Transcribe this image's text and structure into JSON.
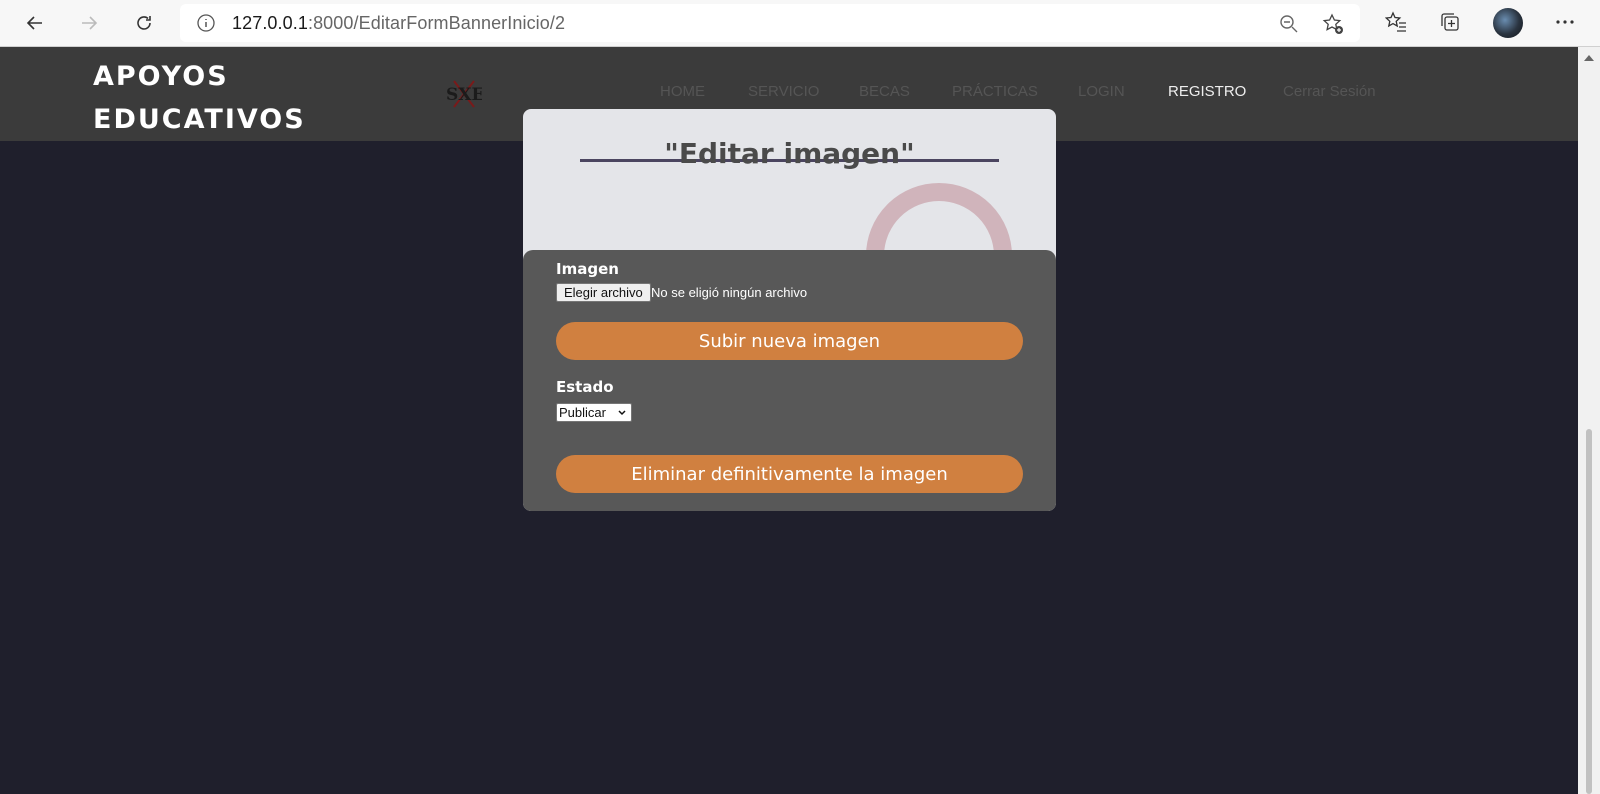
{
  "browser": {
    "url_host": "127.0.0.1",
    "url_path": ":8000/EditarFormBannerInicio/2"
  },
  "header": {
    "brand_line1": "APOYOS",
    "brand_line2": "EDUCATIVOS",
    "logo_text": "SXE",
    "menu": [
      {
        "label": "HOME"
      },
      {
        "label": "SERVICIO"
      },
      {
        "label": "BECAS"
      },
      {
        "label": "PRÁCTICAS"
      },
      {
        "label": "LOGIN"
      },
      {
        "label": "REGISTRO"
      },
      {
        "label": "Cerrar Sesión"
      }
    ],
    "active_item": "REGISTRO"
  },
  "modal": {
    "title": "\"Editar imagen\"",
    "image_label": "Imagen",
    "file_button": "Elegir archivo",
    "file_status": "No se eligió ningún archivo",
    "upload_button": "Subir nueva imagen",
    "status_label": "Estado",
    "status_value": "Publicar",
    "delete_button": "Eliminar definitivamente la imagen"
  },
  "colors": {
    "page_bg": "#1f1f2c",
    "header_bg": "#3b3b3b",
    "accent": "#d08040",
    "panel_bg": "#585858"
  }
}
